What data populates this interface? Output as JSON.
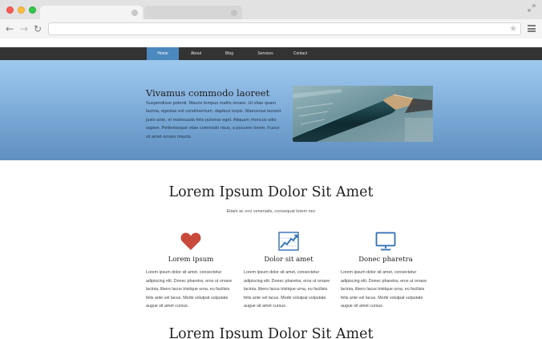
{
  "nav": {
    "items": [
      {
        "label": "Home",
        "active": true
      },
      {
        "label": "About",
        "active": false
      },
      {
        "label": "Blog",
        "active": false
      },
      {
        "label": "Services",
        "active": false
      },
      {
        "label": "Contact",
        "active": false
      }
    ]
  },
  "hero": {
    "title": "Vivamus commodo laoreet",
    "text": "Suspendisse potenti. Mauris tempus mattis ornare. Ut vitae quam lacinia, egestas est condimentum, dapibus turpis. Maecenas laoreet justo ante, et malesuada felis pulvinar eget. Aliquam rhoncus odio sapien. Pellentesque vitae commodo risus, a posuere lorem. Fusce sit amet ornare mauris."
  },
  "section": {
    "title": "Lorem Ipsum Dolor Sit Amet",
    "subtitle": "Etiam ac orci venenatis, consequat lorem nec"
  },
  "features": [
    {
      "icon": "heart-icon",
      "title": "Lorem ipsum",
      "text": "Lorem ipsum dolor sit amet, consectetur adipiscing elit. Donec pharetra, eros ut ornare lacinia, libero lacus tristique urna, eu facilisis felis ante vel lacus. Morbi volutpat vulputate augue sit amet cursus."
    },
    {
      "icon": "chart-icon",
      "title": "Dolor sit amet",
      "text": "Lorem ipsum dolor sit amet, consectetur adipiscing elit. Donec pharetra, eros ut ornare lacinia, libero lacus tristique urna, eu facilisis felis ante vel lacus. Morbi volutpat vulputate augue sit amet cursus."
    },
    {
      "icon": "monitor-icon",
      "title": "Donec pharetra",
      "text": "Lorem ipsum dolor sit amet, consectetur adipiscing elit. Donec pharetra, eros ut ornare lacinia, libero lacus tristique urna, eu facilisis felis ante vel lacus. Morbi volutpat vulputate augue sit amet cursus."
    }
  ],
  "section2": {
    "title": "Lorem Ipsum Dolor Sit Amet"
  },
  "colors": {
    "nav_bg": "#333333",
    "nav_active": "#4a88be",
    "heart": "#c9493a",
    "icon_blue": "#2f6fb3"
  }
}
